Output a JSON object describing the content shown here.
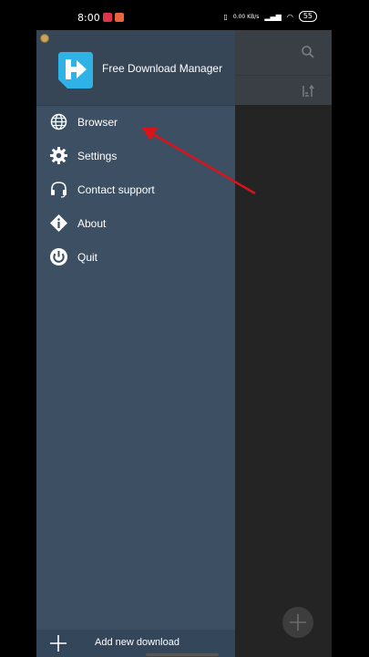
{
  "status_bar": {
    "time": "8:00",
    "net_speed": "0.00 KB/s",
    "battery": "55"
  },
  "colors": {
    "accent": "#2fb3e6",
    "annotation_arrow": "#d9131a",
    "drawer": "#3d4f62"
  },
  "drawer": {
    "app_title": "Free Download Manager",
    "items": [
      {
        "label": "Browser",
        "icon": "globe-icon"
      },
      {
        "label": "Settings",
        "icon": "gear-icon"
      },
      {
        "label": "Contact support",
        "icon": "headset-icon"
      },
      {
        "label": "About",
        "icon": "info-icon"
      },
      {
        "label": "Quit",
        "icon": "power-icon"
      }
    ],
    "footer_label": "Add new download"
  },
  "annotation": {
    "arrow_points_to": "Browser"
  }
}
